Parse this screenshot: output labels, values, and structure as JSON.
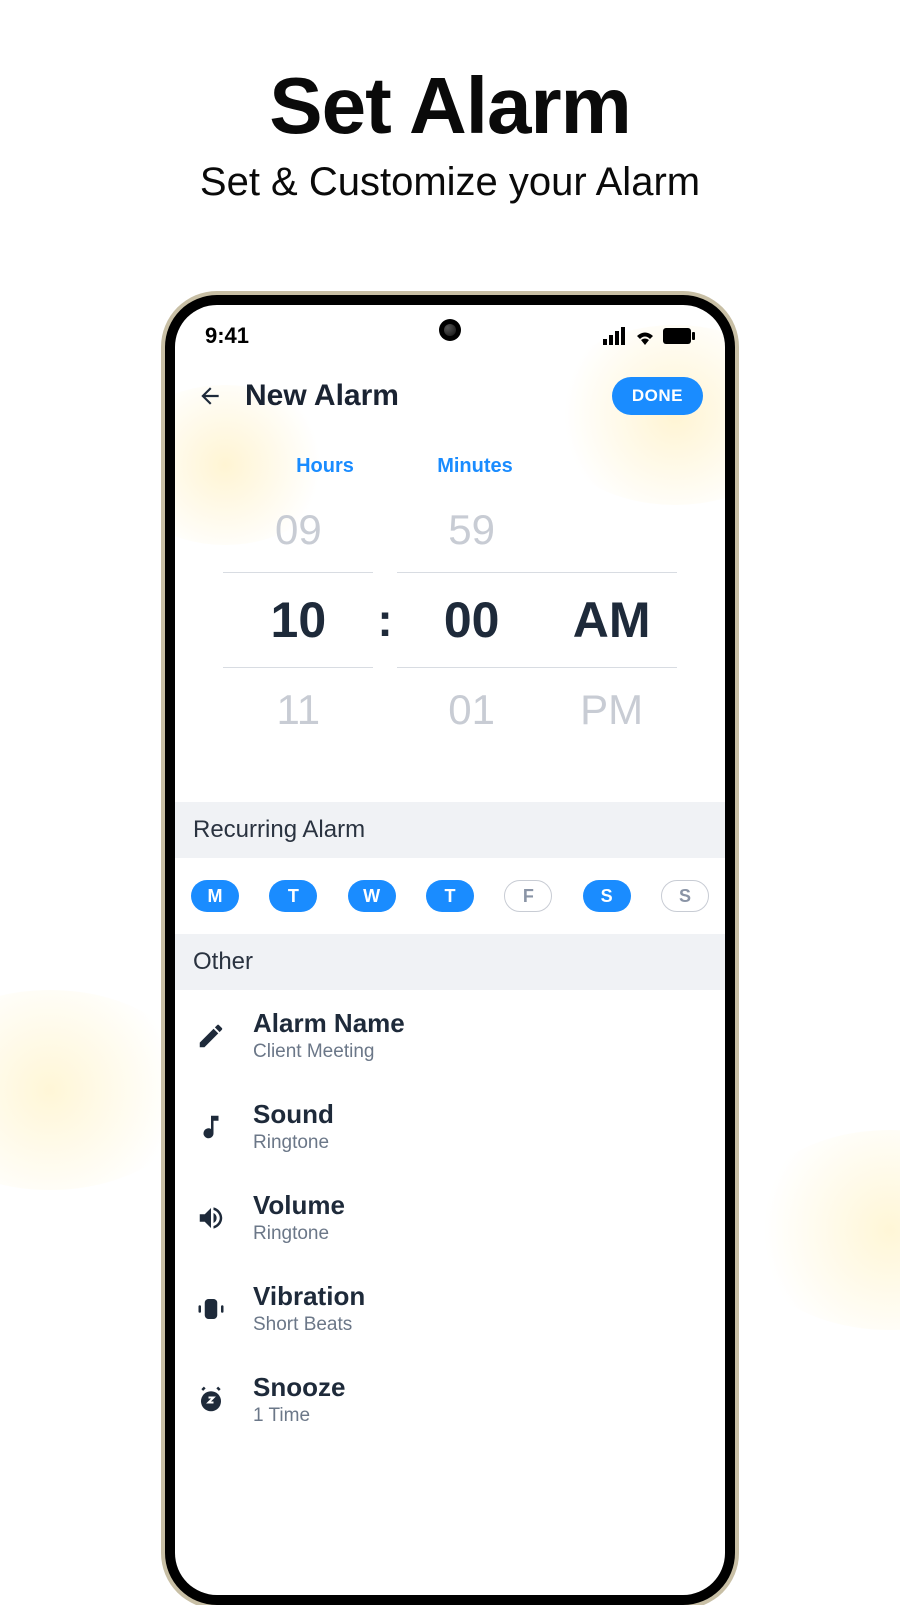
{
  "promo": {
    "title": "Set Alarm",
    "subtitle": "Set & Customize your Alarm"
  },
  "status": {
    "time": "9:41"
  },
  "header": {
    "title": "New Alarm",
    "done": "DONE"
  },
  "picker": {
    "hours_label": "Hours",
    "minutes_label": "Minutes",
    "hour_prev": "09",
    "hour_sel": "10",
    "hour_next": "11",
    "min_prev": "59",
    "min_sel": "00",
    "min_next": "01",
    "ampm_sel": "AM",
    "ampm_next": "PM",
    "colon": ":"
  },
  "recurring": {
    "header": "Recurring Alarm",
    "days": [
      {
        "label": "M",
        "active": true
      },
      {
        "label": "T",
        "active": true
      },
      {
        "label": "W",
        "active": true
      },
      {
        "label": "T",
        "active": true
      },
      {
        "label": "F",
        "active": false
      },
      {
        "label": "S",
        "active": true
      },
      {
        "label": "S",
        "active": false
      }
    ]
  },
  "other": {
    "header": "Other",
    "items": [
      {
        "icon": "pencil",
        "title": "Alarm Name",
        "sub": "Client Meeting"
      },
      {
        "icon": "music",
        "title": "Sound",
        "sub": "Ringtone"
      },
      {
        "icon": "volume",
        "title": "Volume",
        "sub": "Ringtone"
      },
      {
        "icon": "vibration",
        "title": "Vibration",
        "sub": "Short Beats"
      },
      {
        "icon": "snooze",
        "title": "Snooze",
        "sub": "1 Time"
      }
    ]
  },
  "colors": {
    "accent": "#1a8cff"
  }
}
